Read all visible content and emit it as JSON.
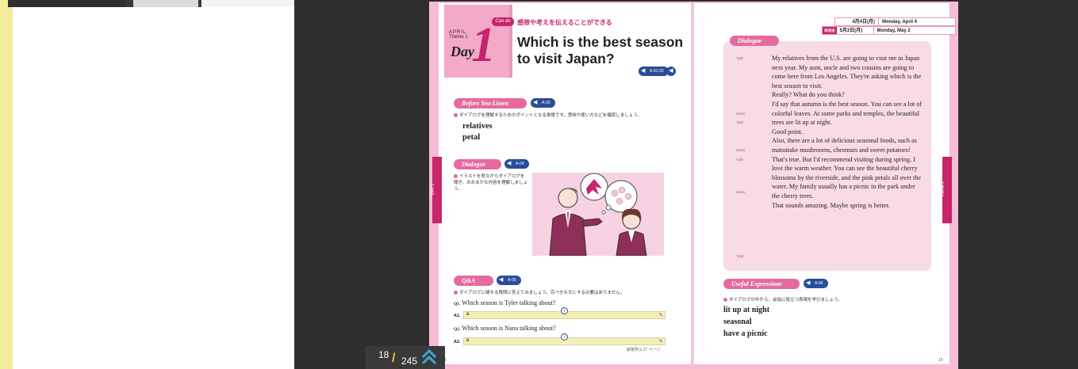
{
  "toolbar": {
    "left_segments": [
      "",
      "",
      ""
    ]
  },
  "page_left": {
    "month": "APRIL",
    "theme": "Theme 1",
    "day_word": "Day",
    "day_number": "1",
    "can_do_badge": "Can do",
    "can_do_text": "感想や考えを伝えることができる",
    "title": "Which is the best season to visit Japan?",
    "title_audio": "A-01-02",
    "side_tab": "DAY 1",
    "before_you_listen": {
      "heading": "Before You Listen",
      "audio": "A-03",
      "note": "ダイアログを理解するためのポイントとなる単語です。意味や使い方などを確認しましょう。",
      "words": [
        "relatives",
        "petal"
      ]
    },
    "dialogue_section": {
      "heading": "Dialogue",
      "audio": "A-04",
      "note": "イラストを見ながらダイアログを聞き、おおまかな内容を理解しましょう。"
    },
    "qa": {
      "heading": "Q&A",
      "audio": "A-05",
      "note": "ダイアログに関する質問に答えてみましょう。完ぺきな文にする必要はありません。",
      "questions": [
        {
          "label": "Q1.",
          "text": "Which season is Tyler talking about?",
          "answer_label": "A1.",
          "answer": "a"
        },
        {
          "label": "Q2.",
          "text": "Which season is Nana talking about?",
          "answer_label": "A2.",
          "answer": "a"
        }
      ],
      "footer": "解答例 p.27 ページ",
      "page_number": "18"
    }
  },
  "page_right": {
    "dates": [
      {
        "jp": "4月4日(月)",
        "en": "Monday, April 4",
        "badge": ""
      },
      {
        "jp": "5月2日(月)",
        "en": "Monday, May 2",
        "badge": "再放送"
      }
    ],
    "dialogue_heading": "Dialogue",
    "side_tab": "Theme 1",
    "lines": [
      {
        "speaker": "Tyler",
        "text": "My relatives from the U.S. are going to visit me in Japan next year. My aunt, uncle and two cousins are going to come here from Los Angeles. They're asking which is the best season to visit."
      },
      {
        "speaker": "Nana",
        "text": "Really? What do you think?"
      },
      {
        "speaker": "Tyler",
        "text": "I'd say that autumn is the best season. You can see a lot of colorful leaves. At some parks and temples, the beautiful trees are lit up at night."
      },
      {
        "speaker": "Nana",
        "text": "Good point."
      },
      {
        "speaker": "Tyler",
        "text": "Also, there are a lot of delicious seasonal foods, such as matsutake mushrooms, chestnuts and sweet potatoes!"
      },
      {
        "speaker": "Nana",
        "text": "That's true. But I'd recommend visiting during spring. I love the warm weather. You can see the beautiful cherry blossoms by the riverside, and the pink petals all over the water. My family usually has a picnic in the park under the cherry trees."
      },
      {
        "speaker": "Tyler",
        "text": "That sounds amazing. Maybe spring is better."
      }
    ],
    "useful_expressions": {
      "heading": "Useful Expressions",
      "audio": "A-06",
      "note": "ダイアログの中から、会話に役立つ表現を学びましょう。",
      "items": [
        "lit up at night",
        "seasonal",
        "have a picnic"
      ]
    },
    "page_number": "19"
  },
  "page_counter": {
    "current": "18",
    "separator": "/",
    "total": "245"
  },
  "colors": {
    "accent_pink": "#c8236d",
    "section_pink": "#e46aa0",
    "audio_blue": "#2a4c9a",
    "viewer_bg": "#2e2e2e",
    "left_strip": "#f3ec9a",
    "counter_slash": "#f2c230"
  }
}
